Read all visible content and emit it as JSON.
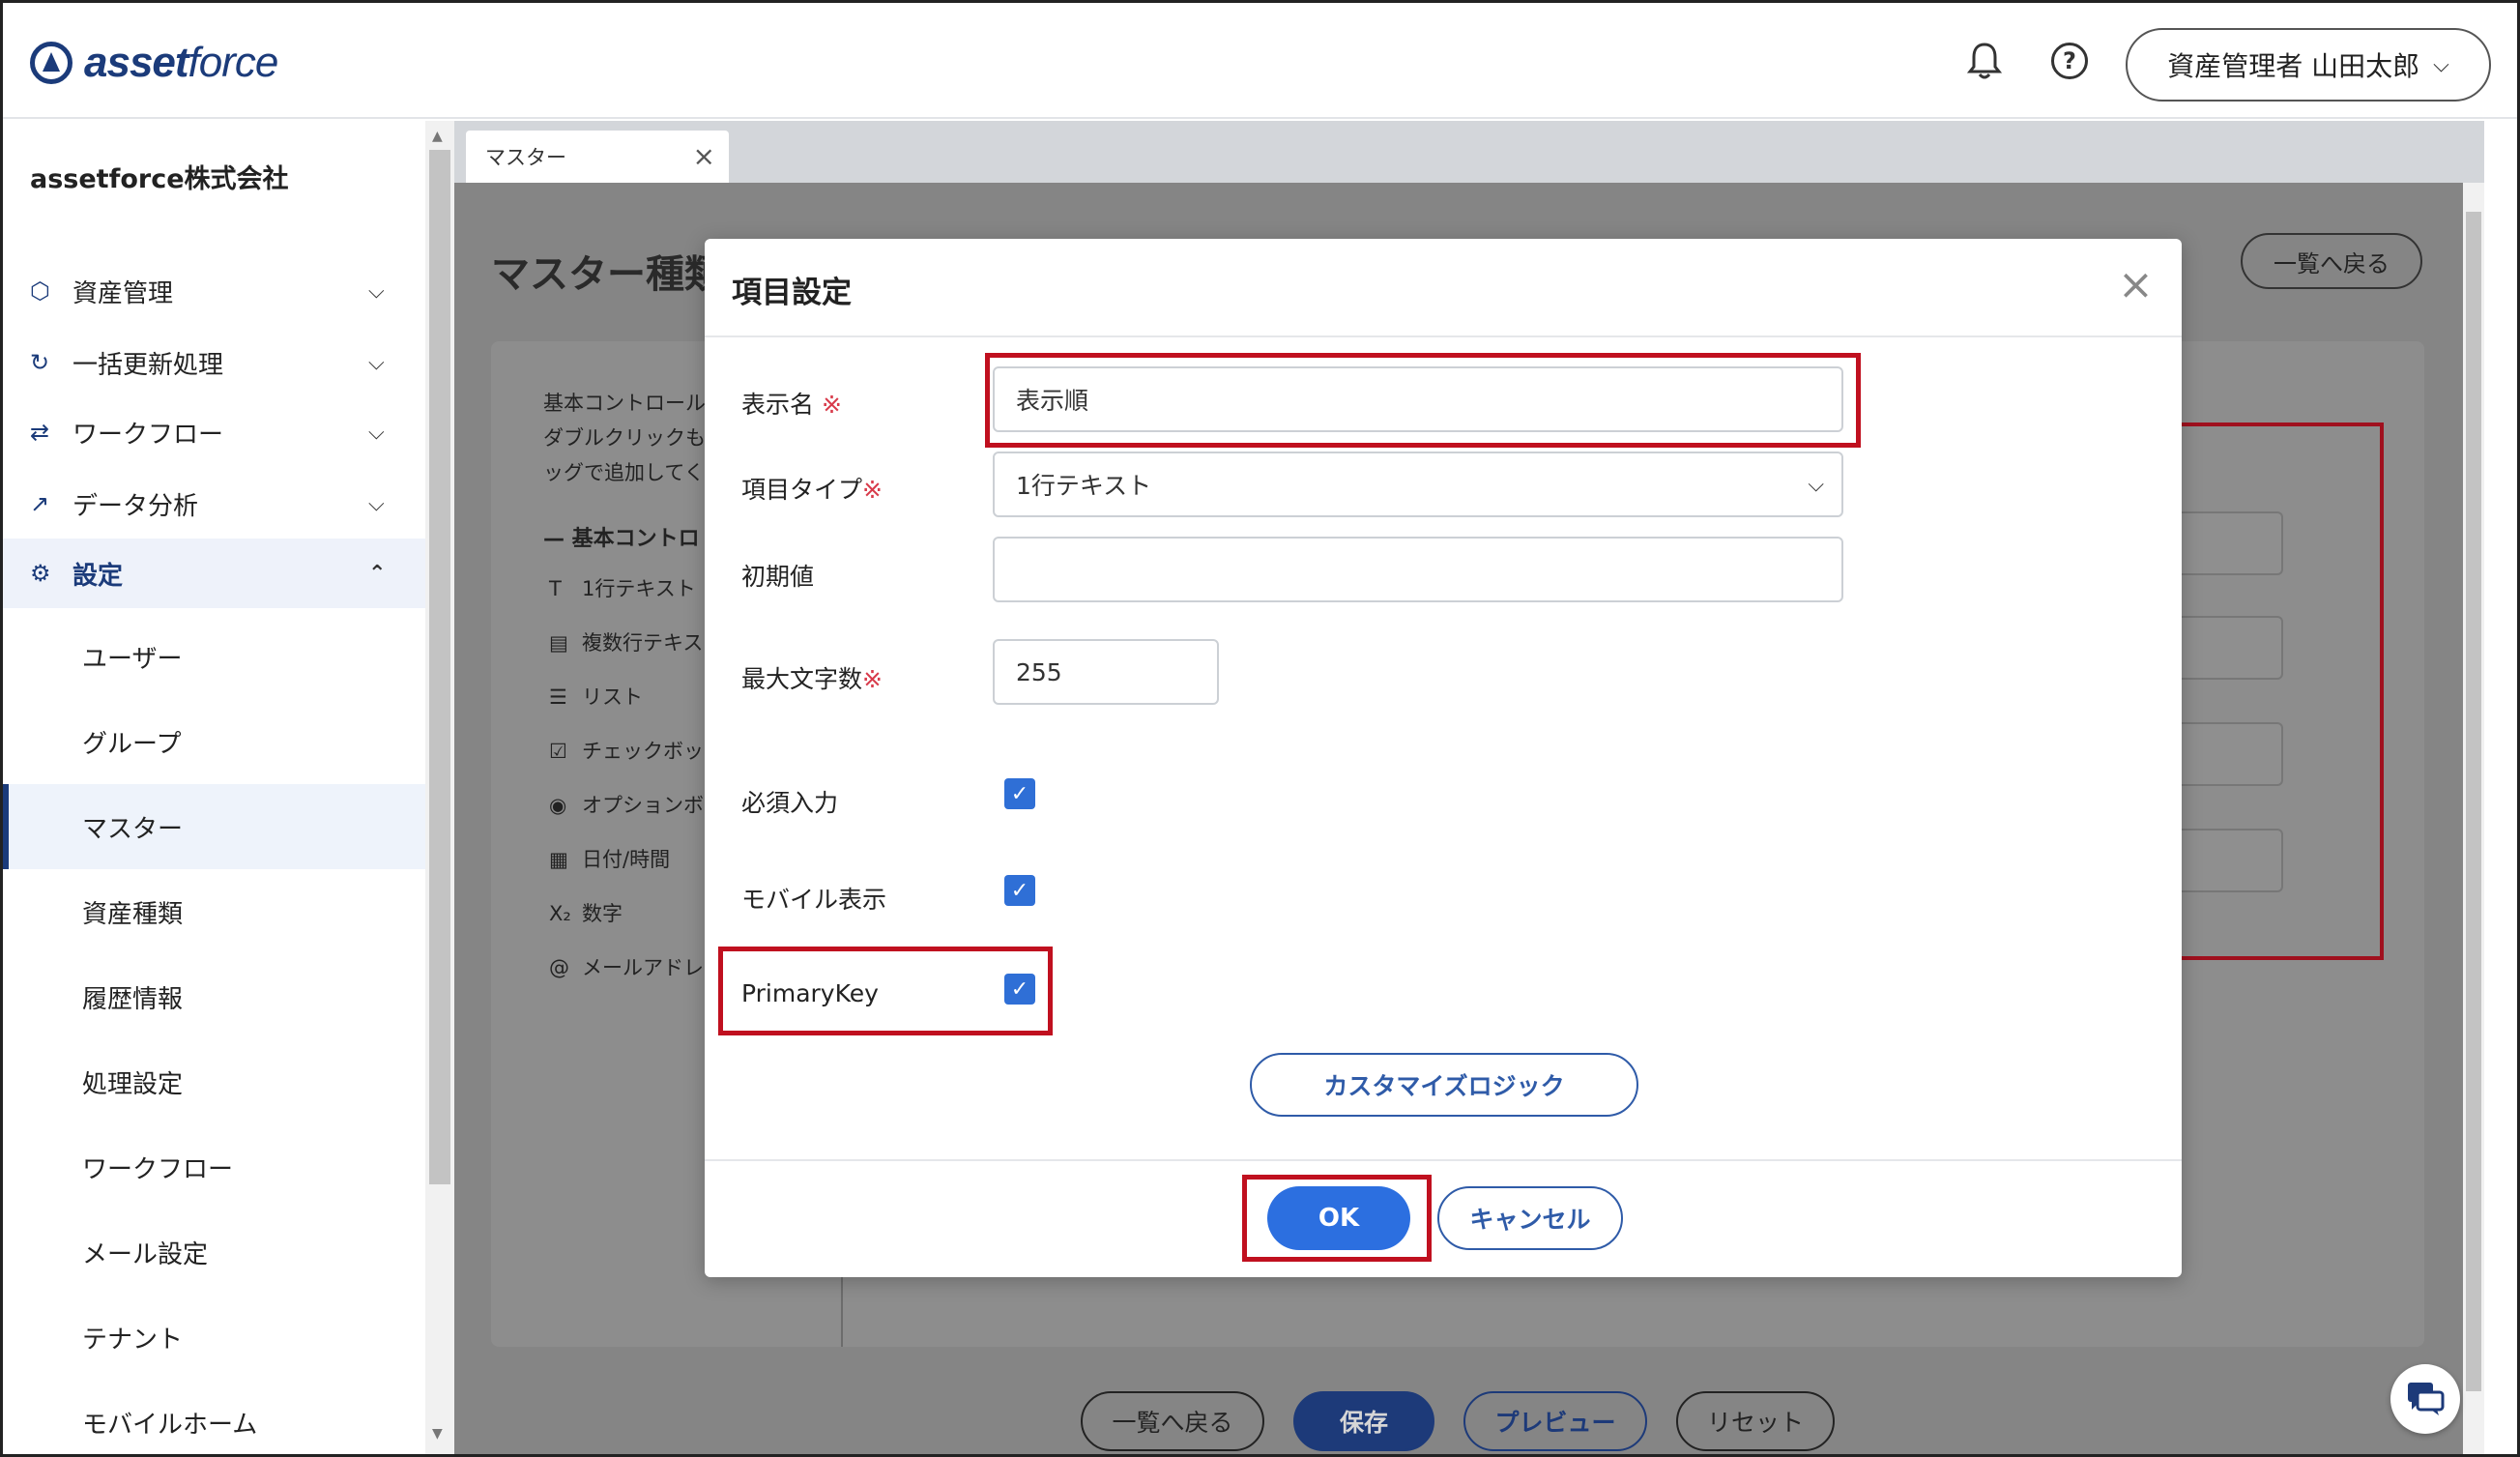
{
  "header": {
    "logo_text_a": "asset",
    "logo_text_b": "force",
    "user_label": "資産管理者 山田太郎"
  },
  "sidebar": {
    "company": "assetforce株式会社",
    "groups": [
      {
        "label": "資産管理"
      },
      {
        "label": "一括更新処理"
      },
      {
        "label": "ワークフロー"
      },
      {
        "label": "データ分析"
      },
      {
        "label": "設定"
      }
    ],
    "sub_items": [
      {
        "label": "ユーザー"
      },
      {
        "label": "グループ"
      },
      {
        "label": "マスター"
      },
      {
        "label": "資産種類"
      },
      {
        "label": "履歴情報"
      },
      {
        "label": "処理設定"
      },
      {
        "label": "ワークフロー"
      },
      {
        "label": "メール設定"
      },
      {
        "label": "テナント"
      },
      {
        "label": "モバイルホーム"
      }
    ]
  },
  "main": {
    "tab_label": "マスター",
    "page_title": "マスター種類",
    "back_top_label": "一覧へ戻る",
    "help_text": [
      "基本コントロール",
      "ダブルクリックも",
      "ッグで追加してく"
    ],
    "controls_heading": "基本コントロ",
    "controls": [
      {
        "icon": "T",
        "label": "1行テキスト"
      },
      {
        "icon": "▤",
        "label": "複数行テキス"
      },
      {
        "icon": "☰",
        "label": "リスト"
      },
      {
        "icon": "☑",
        "label": "チェックボッ"
      },
      {
        "icon": "◉",
        "label": "オプションボ"
      },
      {
        "icon": "▦",
        "label": "日付/時間"
      },
      {
        "icon": "X₂",
        "label": "数字"
      },
      {
        "icon": "@",
        "label": "メールアドレ"
      }
    ],
    "bottom_buttons": {
      "back": "一覧へ戻る",
      "save": "保存",
      "preview": "プレビュー",
      "reset": "リセット"
    }
  },
  "modal": {
    "title": "項目設定",
    "fields": {
      "display_name_label": "表示名",
      "display_name_value": "表示順",
      "type_label": "項目タイプ",
      "type_value": "1行テキスト",
      "default_label": "初期値",
      "default_value": "",
      "maxlen_label": "最大文字数",
      "maxlen_value": "255",
      "required_label": "必須入力",
      "mobile_label": "モバイル表示",
      "pk_label": "PrimaryKey"
    },
    "required_mark": "※",
    "custom_logic_label": "カスタマイズロジック",
    "ok_label": "OK",
    "cancel_label": "キャンセル"
  },
  "colors": {
    "brand": "#1b3b7a",
    "primary_button": "#2c6fe0",
    "highlight": "#c0101f",
    "required": "#d83b4b"
  }
}
